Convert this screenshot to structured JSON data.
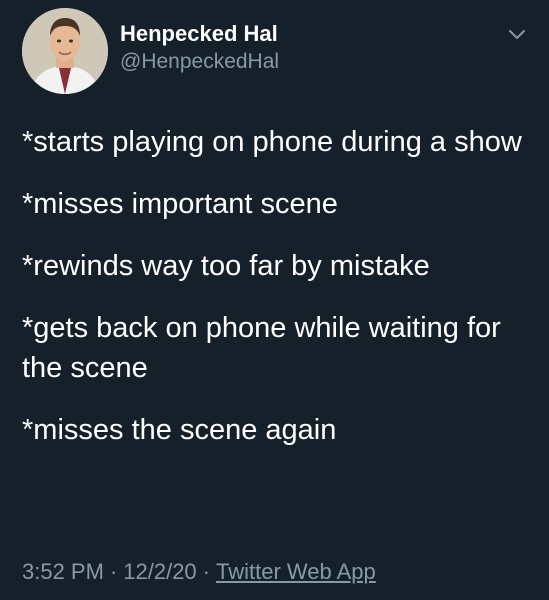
{
  "author": {
    "display_name": "Henpecked Hal",
    "handle": "@HenpeckedHal",
    "avatar_icon": "profile-photo"
  },
  "menu_icon": "chevron-down-icon",
  "tweet_lines": [
    "*starts playing on phone during a show",
    "*misses important scene",
    "*rewinds way too far by mistake",
    "*gets back on phone while waiting for the scene",
    "*misses the scene again"
  ],
  "footer": {
    "time": "3:52 PM",
    "separator": "·",
    "date": "12/2/20",
    "app": "Twitter Web App"
  },
  "colors": {
    "background": "#15202b",
    "text": "#ffffff",
    "secondary_text": "#8899a6"
  }
}
